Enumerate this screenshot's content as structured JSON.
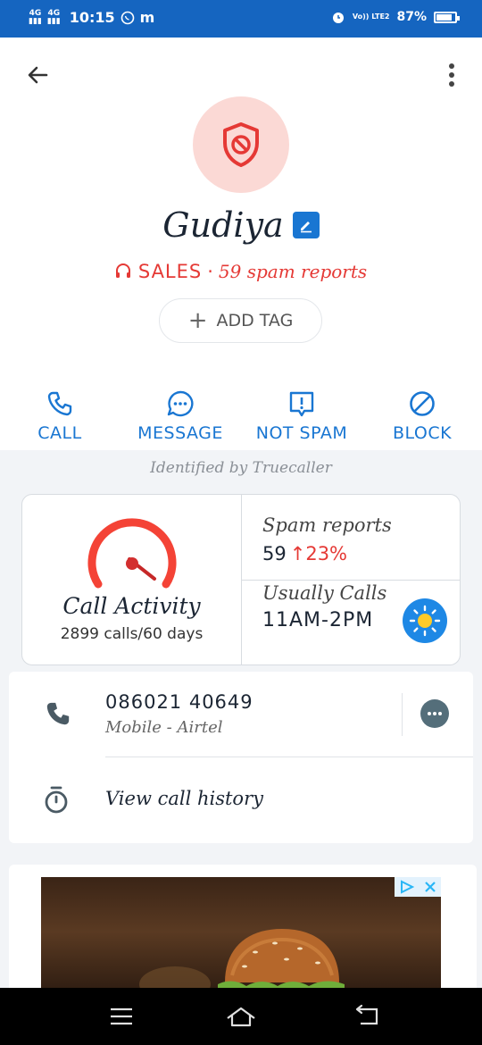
{
  "status_bar": {
    "net1": "4G",
    "net2": "4G",
    "time": "10:15",
    "whatsapp_icon": "whatsapp-icon",
    "m_label": "m",
    "alarm_icon": "alarm-icon",
    "volte": "Vo)) LTE2",
    "battery": "87%",
    "battery_level": 0.87
  },
  "header": {
    "back_icon": "arrow-left-icon",
    "menu_icon": "more-vert-icon"
  },
  "profile": {
    "avatar_icon": "shield-block-icon",
    "name": "Gudiya",
    "edit_icon": "edit-icon",
    "tag_icon": "headset-icon",
    "tag": "SALES",
    "separator": "·",
    "spam_reports": "59 spam reports",
    "add_tag": "ADD TAG",
    "add_tag_plus": "+"
  },
  "actions": [
    {
      "label": "CALL",
      "icon": "phone-icon"
    },
    {
      "label": "MESSAGE",
      "icon": "chat-icon"
    },
    {
      "label": "NOT SPAM",
      "icon": "report-icon"
    },
    {
      "label": "BLOCK",
      "icon": "block-icon"
    }
  ],
  "identified_by": "Identified by Truecaller",
  "stats": {
    "gauge_icon": "speedometer-icon",
    "call_activity_title": "Call Activity",
    "call_activity_sub": "2899 calls/60 days",
    "spam_reports_title": "Spam reports",
    "spam_reports_value": "59",
    "spam_reports_trend": "↑23%",
    "usually_calls_title": "Usually Calls",
    "usually_calls_value": "11AM-2PM",
    "sun_icon": "sun-icon"
  },
  "number_card": {
    "phone_icon": "phone-icon",
    "number": "086021 40649",
    "carrier": "Mobile - Airtel",
    "message_icon": "message-icon",
    "timer_icon": "timer-icon",
    "history": "View call history"
  },
  "ad": {
    "image": "burger-ad-image",
    "adchoices_icon": "adchoices-icon",
    "close_icon": "close-icon"
  },
  "nav": {
    "recents_icon": "recents-icon",
    "home_icon": "home-icon",
    "back_icon": "back-icon"
  },
  "colors": {
    "primary": "#1976d2",
    "spam_red": "#e53935",
    "status_bar": "#1565c0"
  }
}
